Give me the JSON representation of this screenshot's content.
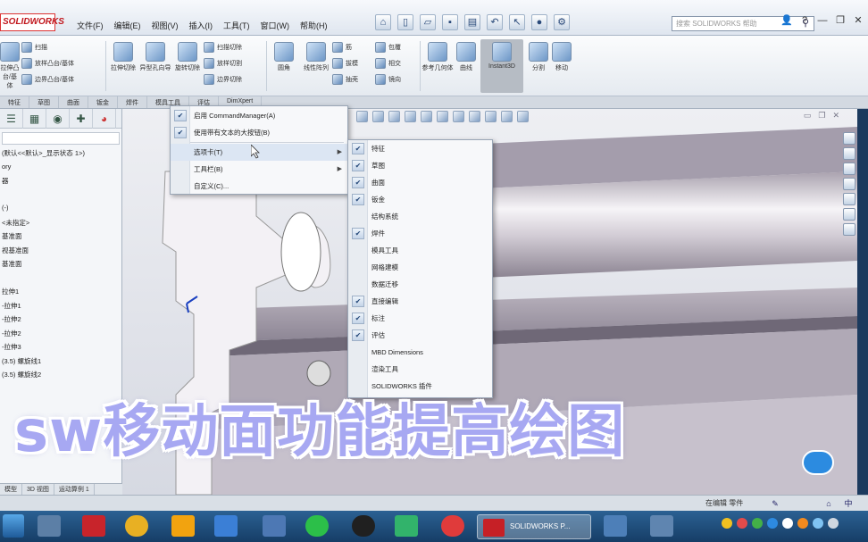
{
  "app": {
    "logo": "SOLIDWORKS"
  },
  "menubar": {
    "items": [
      "文件(F)",
      "编辑(E)",
      "视图(V)",
      "插入(I)",
      "工具(T)",
      "窗口(W)",
      "帮助(H)"
    ],
    "search_placeholder": "搜索 SOLIDWORKS 帮助"
  },
  "ribbon": {
    "big1": "拉伸凸台/基体",
    "big2": "旋转凸台/基体",
    "small": [
      "扫描",
      "放样凸台/基体",
      "边界凸台/基体"
    ],
    "big3": "拉伸切除",
    "big4": "异型孔向导",
    "big5": "旋转切除",
    "small2": [
      "扫描切除",
      "放样切割",
      "边界切除"
    ],
    "big6": "圆角",
    "big7": "线性阵列",
    "small3": [
      "筋",
      "拔模",
      "抽壳"
    ],
    "small4": [
      "包覆",
      "相交",
      "镜向"
    ],
    "big8": "参考几何体",
    "big9": "曲线",
    "big10": "Instant3D",
    "big11": "分割",
    "big12": "移动"
  },
  "cmtabs": [
    "特征",
    "草图",
    "曲面",
    "钣金",
    "焊件",
    "模具工具",
    "评估",
    "DimXpert"
  ],
  "leftpanel": {
    "items": [
      "(默认<<默认>_显示状态 1>)",
      "ory",
      "器",
      "",
      "(-)",
      "<未指定>",
      "基准面",
      "视基准面",
      "基准面",
      "",
      "拉伸1",
      "-拉伸1",
      "-拉伸2",
      "-拉伸2",
      "-拉伸3",
      "(3.5) 螺旋线1",
      "(3.5) 螺旋线2"
    ],
    "bottom_tabs": [
      "模型",
      "3D 视图",
      "运动算例 1"
    ]
  },
  "ctx1": {
    "items": [
      {
        "label": "启用 CommandManager(A)",
        "checked": true
      },
      {
        "label": "使用带有文本的大按钮(B)",
        "checked": true
      },
      {
        "label": "选项卡(T)",
        "checked": false,
        "submenu": true
      },
      {
        "label": "工具栏(B)",
        "checked": false,
        "submenu": true
      },
      {
        "label": "自定义(C)...",
        "checked": false
      }
    ]
  },
  "ctx2": {
    "items": [
      {
        "label": "特征",
        "checked": true
      },
      {
        "label": "草图",
        "checked": true
      },
      {
        "label": "曲面",
        "checked": true
      },
      {
        "label": "钣金",
        "checked": true
      },
      {
        "label": "结构系统",
        "checked": false
      },
      {
        "label": "焊件",
        "checked": true
      },
      {
        "label": "模具工具",
        "checked": false
      },
      {
        "label": "网格建模",
        "checked": false
      },
      {
        "label": "数据迁移",
        "checked": false
      },
      {
        "label": "直接编辑",
        "checked": true
      },
      {
        "label": "标注",
        "checked": true
      },
      {
        "label": "评估",
        "checked": true
      },
      {
        "label": "MBD Dimensions",
        "checked": false
      },
      {
        "label": "渲染工具",
        "checked": false
      },
      {
        "label": "SOLIDWORKS 插件",
        "checked": false
      }
    ]
  },
  "statusbar": {
    "text": "在编辑 零件"
  },
  "taskbar": {
    "active_label": "SOLIDWORKS P..."
  },
  "caption": "sw移动面功能提高绘图"
}
